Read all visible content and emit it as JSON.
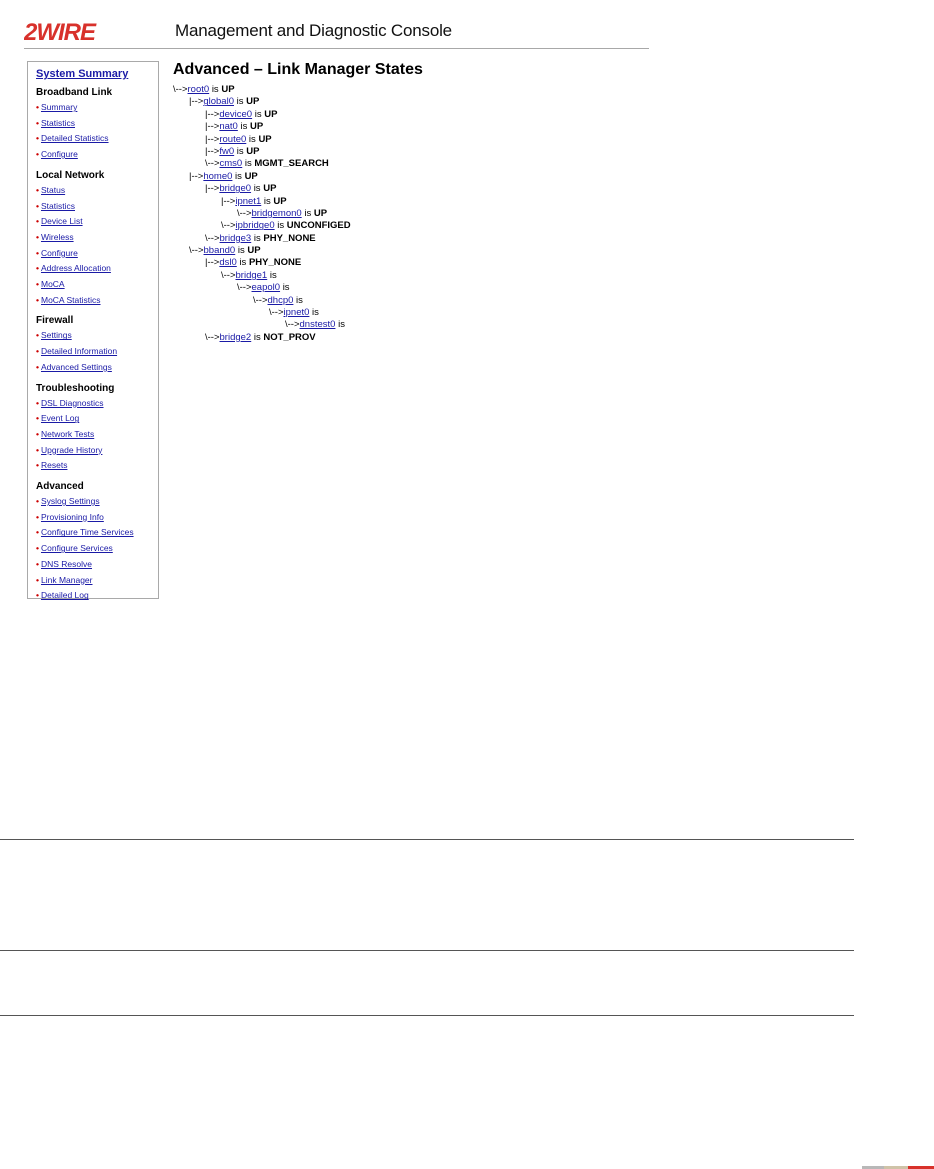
{
  "header": {
    "logo_text": "2WIRE",
    "title": "Management and Diagnostic Console"
  },
  "sidebar": {
    "summary_link": "System Summary",
    "groups": [
      {
        "title": "Broadband Link",
        "items": [
          "Summary",
          "Statistics",
          "Detailed Statistics",
          "Configure"
        ]
      },
      {
        "title": "Local Network",
        "items": [
          "Status",
          "Statistics",
          "Device List",
          "Wireless",
          "Configure",
          "Address Allocation",
          "MoCA",
          "MoCA Statistics"
        ]
      },
      {
        "title": "Firewall",
        "items": [
          "Settings",
          "Detailed Information",
          "Advanced Settings"
        ]
      },
      {
        "title": "Troubleshooting",
        "items": [
          "DSL Diagnostics",
          "Event Log",
          "Network Tests",
          "Upgrade History",
          "Resets"
        ]
      },
      {
        "title": "Advanced",
        "items": [
          "Syslog Settings",
          "Provisioning Info",
          "Configure Time Services",
          "Configure Services",
          "DNS Resolve",
          "Link Manager",
          "Detailed Log"
        ]
      }
    ]
  },
  "main": {
    "title": "Advanced – Link Manager States",
    "tree": [
      {
        "depth": 0,
        "prefix": "\\-->",
        "name": "root0",
        "is": "is",
        "state": "UP"
      },
      {
        "depth": 1,
        "prefix": "|-->",
        "name": "global0",
        "is": "is",
        "state": "UP"
      },
      {
        "depth": 2,
        "prefix": "|-->",
        "name": "device0",
        "is": "is",
        "state": "UP"
      },
      {
        "depth": 2,
        "prefix": "|-->",
        "name": "nat0",
        "is": "is",
        "state": "UP"
      },
      {
        "depth": 2,
        "prefix": "|-->",
        "name": "route0",
        "is": "is",
        "state": "UP"
      },
      {
        "depth": 2,
        "prefix": "|-->",
        "name": "fw0",
        "is": "is",
        "state": "UP"
      },
      {
        "depth": 2,
        "prefix": "\\-->",
        "name": "cms0",
        "is": "is",
        "state": "MGMT_SEARCH"
      },
      {
        "depth": 1,
        "prefix": "|-->",
        "name": "home0",
        "is": "is",
        "state": "UP"
      },
      {
        "depth": 2,
        "prefix": "|-->",
        "name": "bridge0",
        "is": "is",
        "state": "UP"
      },
      {
        "depth": 3,
        "prefix": "|-->",
        "name": "ipnet1",
        "is": "is",
        "state": "UP"
      },
      {
        "depth": 4,
        "prefix": "\\-->",
        "name": "bridgemon0",
        "is": "is",
        "state": "UP"
      },
      {
        "depth": 3,
        "prefix": "\\-->",
        "name": "ipbridge0",
        "is": "is",
        "state": "UNCONFIGED"
      },
      {
        "depth": 2,
        "prefix": "\\-->",
        "name": "bridge3",
        "is": "is",
        "state": "PHY_NONE"
      },
      {
        "depth": 1,
        "prefix": "\\-->",
        "name": "bband0",
        "is": "is",
        "state": "UP"
      },
      {
        "depth": 2,
        "prefix": "|-->",
        "name": "dsl0",
        "is": "is",
        "state": "PHY_NONE"
      },
      {
        "depth": 3,
        "prefix": "\\-->",
        "name": "bridge1",
        "is": "is",
        "state": ""
      },
      {
        "depth": 4,
        "prefix": "\\-->",
        "name": "eapol0",
        "is": "is",
        "state": ""
      },
      {
        "depth": 5,
        "prefix": "\\-->",
        "name": "dhcp0",
        "is": "is",
        "state": ""
      },
      {
        "depth": 6,
        "prefix": "\\-->",
        "name": "ipnet0",
        "is": "is",
        "state": ""
      },
      {
        "depth": 7,
        "prefix": "\\-->",
        "name": "dnstest0",
        "is": "is",
        "state": ""
      },
      {
        "depth": 2,
        "prefix": "\\-->",
        "name": "bridge2",
        "is": "is",
        "state": "NOT_PROV"
      }
    ]
  },
  "colors": {
    "link": "#1a1aa6",
    "bullet": "#cc0000",
    "logo_red": "#d8312b",
    "corner_gray": "#b8b8b8",
    "corner_tan": "#cfc3a8",
    "corner_red": "#d8312b"
  }
}
